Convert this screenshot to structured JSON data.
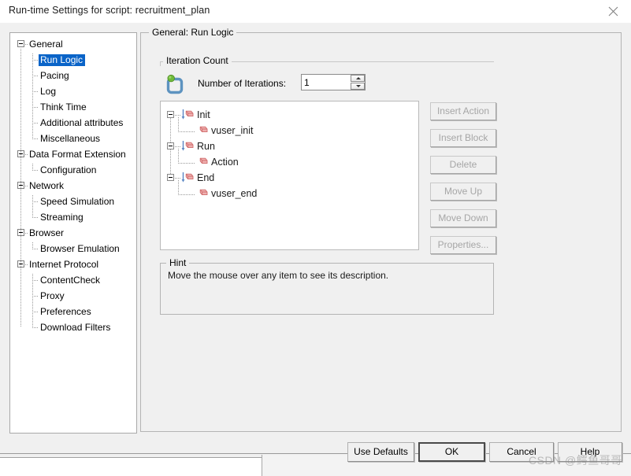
{
  "window": {
    "title": "Run-time Settings for script: recruitment_plan",
    "close_icon": "close-icon"
  },
  "sidebar": {
    "items": [
      {
        "label": "General",
        "level": 0,
        "expanded": true,
        "selected": false
      },
      {
        "label": "Run Logic",
        "level": 1,
        "expanded": false,
        "selected": true
      },
      {
        "label": "Pacing",
        "level": 1,
        "expanded": false,
        "selected": false
      },
      {
        "label": "Log",
        "level": 1,
        "expanded": false,
        "selected": false
      },
      {
        "label": "Think Time",
        "level": 1,
        "expanded": false,
        "selected": false
      },
      {
        "label": "Additional attributes",
        "level": 1,
        "expanded": false,
        "selected": false
      },
      {
        "label": "Miscellaneous",
        "level": 1,
        "expanded": false,
        "selected": false
      },
      {
        "label": "Data Format Extension",
        "level": 0,
        "expanded": true,
        "selected": false
      },
      {
        "label": "Configuration",
        "level": 1,
        "expanded": false,
        "selected": false
      },
      {
        "label": "Network",
        "level": 0,
        "expanded": true,
        "selected": false
      },
      {
        "label": "Speed Simulation",
        "level": 1,
        "expanded": false,
        "selected": false
      },
      {
        "label": "Streaming",
        "level": 1,
        "expanded": false,
        "selected": false
      },
      {
        "label": "Browser",
        "level": 0,
        "expanded": true,
        "selected": false
      },
      {
        "label": "Browser Emulation",
        "level": 1,
        "expanded": false,
        "selected": false
      },
      {
        "label": "Internet Protocol",
        "level": 0,
        "expanded": true,
        "selected": false
      },
      {
        "label": "ContentCheck",
        "level": 1,
        "expanded": false,
        "selected": false
      },
      {
        "label": "Proxy",
        "level": 1,
        "expanded": false,
        "selected": false
      },
      {
        "label": "Preferences",
        "level": 1,
        "expanded": false,
        "selected": false
      },
      {
        "label": "Download Filters",
        "level": 1,
        "expanded": false,
        "selected": false
      }
    ]
  },
  "main": {
    "group_caption": "General: Run Logic",
    "iteration": {
      "caption": "Iteration Count",
      "icon": "iteration-loop-icon",
      "label": "Number of Iterations:",
      "value": "1"
    },
    "run_logic_tree": [
      {
        "label": "Init",
        "level": 0,
        "expanded": true,
        "icon": "block-arrow-icon"
      },
      {
        "label": "vuser_init",
        "level": 1,
        "expanded": false,
        "icon": "block-icon"
      },
      {
        "label": "Run",
        "level": 0,
        "expanded": true,
        "icon": "block-arrow-icon"
      },
      {
        "label": "Action",
        "level": 1,
        "expanded": false,
        "icon": "block-icon"
      },
      {
        "label": "End",
        "level": 0,
        "expanded": true,
        "icon": "block-arrow-icon"
      },
      {
        "label": "vuser_end",
        "level": 1,
        "expanded": false,
        "icon": "block-icon"
      }
    ],
    "side_buttons": [
      {
        "label": "Insert Action",
        "enabled": false
      },
      {
        "label": "Insert Block",
        "enabled": false
      },
      {
        "label": "Delete",
        "enabled": false
      },
      {
        "label": "Move Up",
        "enabled": false
      },
      {
        "label": "Move Down",
        "enabled": false
      },
      {
        "label": "Properties...",
        "enabled": false
      }
    ],
    "hint": {
      "caption": "Hint",
      "text": "Move the mouse over any item to see its description."
    }
  },
  "footer": {
    "buttons": [
      {
        "label": "Use Defaults",
        "default": false
      },
      {
        "label": "OK",
        "default": true
      },
      {
        "label": "Cancel",
        "default": false
      },
      {
        "label": "Help",
        "default": false
      }
    ]
  },
  "watermark": {
    "text": "CSDN @鳄鱼哥哥"
  },
  "colors": {
    "selection_blue": "#0a64c8",
    "dialog_face": "#f0f0f0",
    "icon_block_pink": "#e8a0a0",
    "icon_loop_blue": "#4f86b8",
    "icon_dot_green": "#6fba3a"
  }
}
